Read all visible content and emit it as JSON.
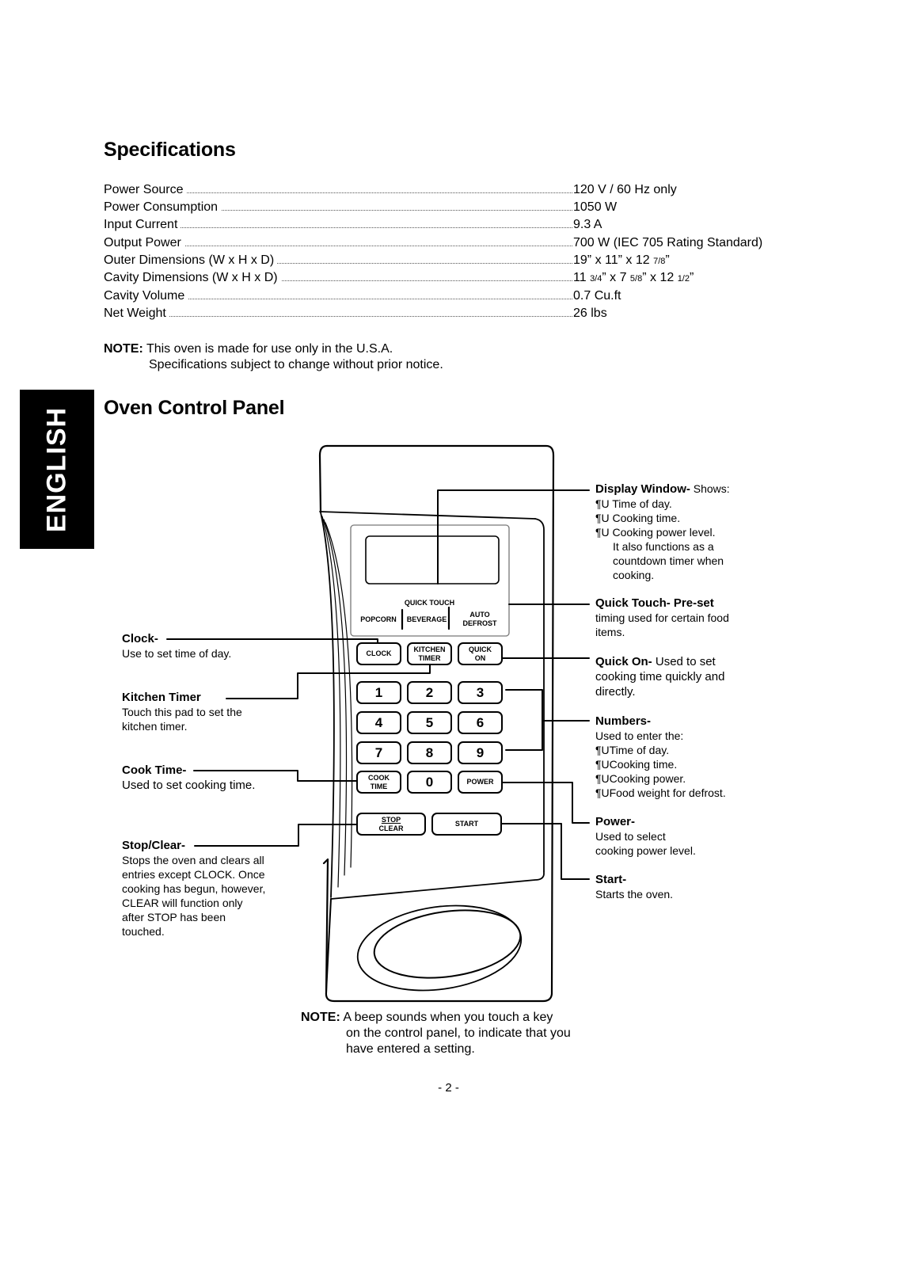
{
  "specifications": {
    "title": "Specifications",
    "rows": [
      {
        "label": "Power Source",
        "value": "120 V / 60 Hz only"
      },
      {
        "label": "Power Consumption",
        "value": "1050 W"
      },
      {
        "label": "Input Current",
        "value": "9.3 A"
      },
      {
        "label": "Output Power",
        "value": "700 W (IEC 705 Rating Standard)"
      },
      {
        "label": "Outer Dimensions (W x H x D)",
        "value_parts": [
          "19” x 11” x 12 ",
          "7/8",
          "”"
        ]
      },
      {
        "label": "Cavity Dimensions (W x H x D)",
        "value_parts": [
          "11 ",
          "3/4",
          "” x 7 ",
          "5/8",
          "” x 12 ",
          "1/2",
          "”"
        ]
      },
      {
        "label": "Cavity Volume",
        "value": "0.7 Cu.ft"
      },
      {
        "label": "Net Weight",
        "value": "26 lbs"
      }
    ],
    "note_label": "NOTE:",
    "note_line1": "This oven is made for use only in the U.S.A.",
    "note_line2": "Specifications subject to change without prior notice."
  },
  "language_tab": "ENGLISH",
  "control_panel": {
    "title": "Oven Control Panel",
    "quick_touch_heading": "QUICK TOUCH",
    "quick_touch_items": [
      "POPCORN",
      "BEVERAGE",
      "AUTO\nDEFROST"
    ],
    "keys": {
      "clock": "CLOCK",
      "kitchen_timer": [
        "KITCHEN",
        "TIMER"
      ],
      "quick_on": [
        "QUICK",
        "ON"
      ],
      "digits": [
        "1",
        "2",
        "3",
        "4",
        "5",
        "6",
        "7",
        "8",
        "9",
        "0"
      ],
      "cook_time": [
        "COOK",
        "TIME"
      ],
      "power": "POWER",
      "stop": "STOP",
      "clear": "CLEAR",
      "start": "START"
    },
    "left_callouts": {
      "clock": {
        "title": "Clock-",
        "text": "Use to set time of day."
      },
      "kitchen_timer": {
        "title": "Kitchen Timer",
        "text1": "Touch this pad to set the",
        "text2": "kitchen timer."
      },
      "cook_time": {
        "title": "Cook Time-",
        "text": "Used to set cooking time."
      },
      "stop_clear": {
        "title": "Stop/Clear-",
        "lines": [
          "Stops the oven and clears all",
          "entries except CLOCK. Once",
          "cooking has begun, however,",
          "CLEAR will function only",
          "after STOP has been",
          "touched."
        ]
      }
    },
    "right_callouts": {
      "display_window": {
        "title": "Display Window-",
        "title_suffix": " Shows:",
        "bullets": [
          "¶U Time of day.",
          "¶U Cooking time.",
          "¶U Cooking power level."
        ],
        "extra": [
          "It also functions as a",
          "countdown timer when",
          "cooking."
        ]
      },
      "quick_touch": {
        "title": "Quick Touch- Pre-set",
        "lines": [
          "timing used for certain food",
          "items."
        ]
      },
      "quick_on": {
        "title": "Quick On-",
        "title_suffix": " Used to set",
        "lines": [
          "cooking time quickly and",
          "directly."
        ]
      },
      "numbers": {
        "title": "Numbers-",
        "lines": [
          "Used to enter the:",
          "¶UTime of day.",
          "¶UCooking time.",
          "¶UCooking power.",
          "¶UFood weight for defrost."
        ]
      },
      "power": {
        "title": "Power-",
        "lines": [
          "Used to select",
          "cooking power level."
        ]
      },
      "start": {
        "title": "Start-",
        "lines": [
          "Starts the oven."
        ]
      }
    },
    "note_label": "NOTE:",
    "note_lines": [
      "A beep sounds when you touch a key",
      "on the control panel, to indicate that you",
      "have entered a setting."
    ]
  },
  "page_number": "- 2 -"
}
